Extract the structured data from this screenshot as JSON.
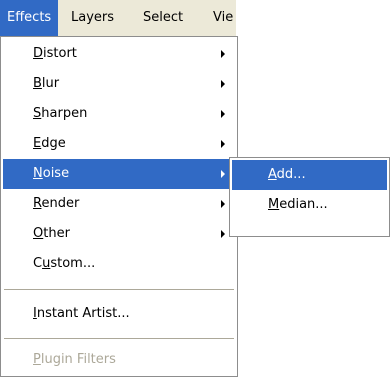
{
  "menubar": {
    "items": [
      {
        "label": "Effects",
        "active": true
      },
      {
        "label": "Layers",
        "active": false
      },
      {
        "label": "Select",
        "active": false
      },
      {
        "label": "Vie",
        "active": false
      }
    ]
  },
  "effects_menu": {
    "items": [
      {
        "label_accel": "D",
        "label_rest": "istort",
        "has_submenu": true
      },
      {
        "label_accel": "B",
        "label_rest": "lur",
        "has_submenu": true
      },
      {
        "label_accel": "S",
        "label_rest": "harpen",
        "has_submenu": true
      },
      {
        "label_accel": "E",
        "label_rest": "dge",
        "has_submenu": true
      },
      {
        "label_accel": "N",
        "label_rest": "oise",
        "has_submenu": true,
        "highlighted": true
      },
      {
        "label_accel": "R",
        "label_rest": "ender",
        "has_submenu": true
      },
      {
        "label_accel": "O",
        "label_rest": "ther",
        "has_submenu": true
      },
      {
        "label_pre": "C",
        "label_accel": "u",
        "label_rest": "stom..."
      },
      {
        "label_accel": "I",
        "label_rest": "nstant Artist..."
      },
      {
        "label_accel": "P",
        "label_rest": "lugin Filters",
        "disabled": true
      }
    ]
  },
  "noise_submenu": {
    "items": [
      {
        "label_accel": "A",
        "label_rest": "dd...",
        "highlighted": true
      },
      {
        "label_accel": "M",
        "label_rest": "edian..."
      }
    ]
  },
  "colors": {
    "highlight": "#316ac5",
    "menubar_bg": "#ece9d8",
    "menu_bg": "#ffffff",
    "border": "#8d8d8d",
    "disabled_text": "#aca899"
  }
}
